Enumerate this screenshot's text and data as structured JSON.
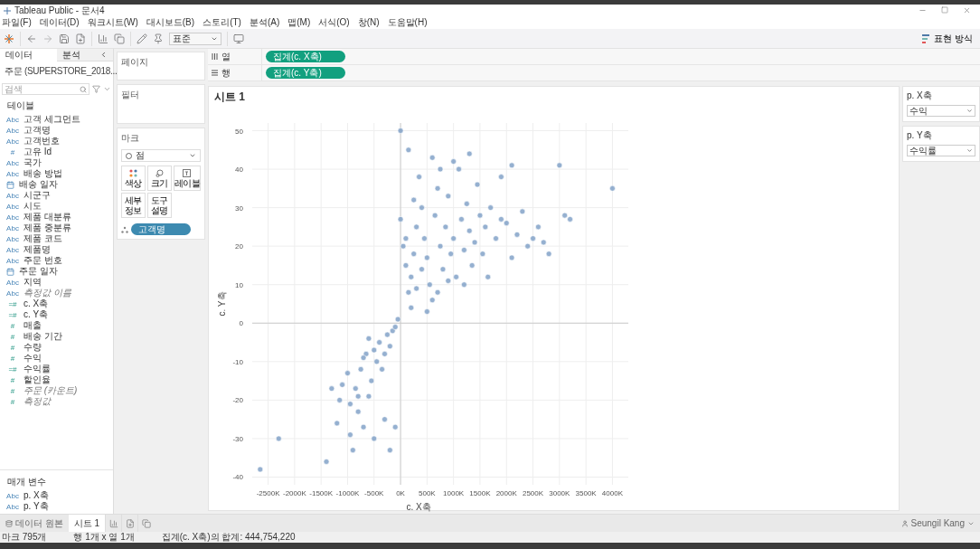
{
  "window": {
    "title": "Tableau Public - 문서4"
  },
  "menu": [
    "파일(F)",
    "데이터(D)",
    "워크시트(W)",
    "대시보드(B)",
    "스토리(T)",
    "분석(A)",
    "맵(M)",
    "서식(O)",
    "창(N)",
    "도움말(H)"
  ],
  "toolbar": {
    "fit_select": "표준",
    "show_me": "표현 방식"
  },
  "data_pane": {
    "tabs": [
      {
        "label": "데이터",
        "selected": true
      },
      {
        "label": "분석",
        "selected": false
      }
    ],
    "datasource": "주문 (SUPERSTORE_2018...",
    "search": {
      "placeholder": "검색"
    },
    "tables_header": "테이블",
    "fields": [
      {
        "kind": "dimension",
        "icon": "Abc",
        "name": "고객 세그먼트",
        "generated": false
      },
      {
        "kind": "dimension",
        "icon": "Abc",
        "name": "고객명",
        "generated": false
      },
      {
        "kind": "dimension",
        "icon": "Abc",
        "name": "고객번호",
        "generated": false
      },
      {
        "kind": "number_dim",
        "icon": "#",
        "name": "고유 Id",
        "generated": false
      },
      {
        "kind": "dimension",
        "icon": "Abc",
        "name": "국가",
        "generated": false
      },
      {
        "kind": "dimension",
        "icon": "Abc",
        "name": "배송 방법",
        "generated": false
      },
      {
        "kind": "date",
        "name": "배송 일자",
        "generated": false
      },
      {
        "kind": "dimension",
        "icon": "Abc",
        "name": "시군구",
        "generated": false
      },
      {
        "kind": "dimension",
        "icon": "Abc",
        "name": "시도",
        "generated": false
      },
      {
        "kind": "dimension",
        "icon": "Abc",
        "name": "제품 대분류",
        "generated": false
      },
      {
        "kind": "dimension",
        "icon": "Abc",
        "name": "제품 중분류",
        "generated": false
      },
      {
        "kind": "dimension",
        "icon": "Abc",
        "name": "제품 코드",
        "generated": false
      },
      {
        "kind": "dimension",
        "icon": "Abc",
        "name": "제품명",
        "generated": false
      },
      {
        "kind": "dimension",
        "icon": "Abc",
        "name": "주문 번호",
        "generated": false
      },
      {
        "kind": "date",
        "name": "주문 일자",
        "generated": false
      },
      {
        "kind": "dimension",
        "icon": "Abc",
        "name": "지역",
        "generated": false
      },
      {
        "kind": "dimension",
        "icon": "Abc",
        "name": "측정값 이름",
        "generated": true
      },
      {
        "kind": "measure",
        "icon": "=#",
        "name": "c. X축",
        "generated": false
      },
      {
        "kind": "measure",
        "icon": "=#",
        "name": "c. Y축",
        "generated": false
      },
      {
        "kind": "measure",
        "icon": "#",
        "name": "매출",
        "generated": false
      },
      {
        "kind": "measure",
        "icon": "#",
        "name": "배송 기간",
        "generated": false
      },
      {
        "kind": "measure",
        "icon": "#",
        "name": "수량",
        "generated": false
      },
      {
        "kind": "measure",
        "icon": "#",
        "name": "수익",
        "generated": false
      },
      {
        "kind": "measure",
        "icon": "=#",
        "name": "수익률",
        "generated": false
      },
      {
        "kind": "measure",
        "icon": "#",
        "name": "할인율",
        "generated": false
      },
      {
        "kind": "measure",
        "icon": "#",
        "name": "주문 (카운트)",
        "generated": true
      },
      {
        "kind": "measure",
        "icon": "#",
        "name": "측정값",
        "generated": true
      }
    ],
    "parameters_header": "매개 변수",
    "parameters": [
      {
        "icon": "Abc",
        "name": "p. X축"
      },
      {
        "icon": "Abc",
        "name": "p. Y축"
      }
    ]
  },
  "cards": {
    "pages": "페이지",
    "filters": "필터",
    "marks": {
      "title": "마크",
      "mark_type": "점",
      "buttons": [
        {
          "kind": "color",
          "label": "색상"
        },
        {
          "kind": "size",
          "label": "크기"
        },
        {
          "kind": "label",
          "label": "레이블"
        },
        {
          "kind": "detail",
          "label": "세부\n정보"
        },
        {
          "kind": "tooltip",
          "label": "도구\n설명"
        }
      ],
      "detail_pill": "고객명"
    }
  },
  "shelves": [
    {
      "kind": "columns",
      "label": "열",
      "pill": "집계(c. X축)"
    },
    {
      "kind": "rows",
      "label": "행",
      "pill": "집계(c. Y축)"
    }
  ],
  "sheet": {
    "title": "시트 1",
    "chart_data": {
      "type": "scatter",
      "grid": true,
      "xlabel": "c. X축",
      "ylabel": "c. Y축",
      "xticks": [
        {
          "value": -2500,
          "label": "-2500K"
        },
        {
          "value": -2000,
          "label": "-2000K"
        },
        {
          "value": -1500,
          "label": "-1500K"
        },
        {
          "value": -1000,
          "label": "-1000K"
        },
        {
          "value": -500,
          "label": "-500K"
        },
        {
          "value": 0,
          "label": "0K"
        },
        {
          "value": 500,
          "label": "500K"
        },
        {
          "value": 1000,
          "label": "1000K"
        },
        {
          "value": 1500,
          "label": "1500K"
        },
        {
          "value": 2000,
          "label": "2000K"
        },
        {
          "value": 2500,
          "label": "2500K"
        },
        {
          "value": 3000,
          "label": "3000K"
        },
        {
          "value": 3500,
          "label": "3500K"
        },
        {
          "value": 4000,
          "label": "4000K"
        }
      ],
      "yticks": [
        -40,
        -30,
        -20,
        -10,
        0,
        10,
        20,
        30,
        40,
        50
      ],
      "xlim": [
        -2800,
        4300
      ],
      "ylim": [
        -42,
        52
      ],
      "x": [
        -2650,
        -2300,
        -1400,
        -1200,
        -900,
        -950,
        -1150,
        -1100,
        -1000,
        -950,
        -700,
        -600,
        -500,
        -300,
        -100,
        -200,
        -800,
        -850,
        -750,
        -650,
        -550,
        -450,
        -400,
        -300,
        -250,
        -200,
        -150,
        -100,
        -50,
        -600,
        -500,
        -350,
        -700,
        0,
        150,
        0,
        50,
        100,
        150,
        200,
        250,
        300,
        350,
        400,
        450,
        500,
        550,
        600,
        650,
        700,
        750,
        800,
        850,
        900,
        950,
        1000,
        1050,
        1100,
        1150,
        1200,
        1250,
        1300,
        1350,
        1400,
        1450,
        1500,
        1550,
        1600,
        1700,
        1800,
        1900,
        2000,
        2100,
        2200,
        2300,
        2400,
        2600,
        2800,
        3000,
        3100,
        3200,
        4000,
        200,
        300,
        400,
        500,
        100,
        250,
        600,
        750,
        1000,
        2100,
        1200,
        700,
        900,
        -800,
        -1300,
        1300,
        2500,
        1650,
        1900,
        2700
      ],
      "series": [
        {
          "color": "#7b9cc4",
          "values": [
            -38,
            -30,
            -36,
            -26,
            -33,
            -29,
            -20,
            -16,
            -13,
            -21,
            -27,
            -19,
            -30,
            -25,
            -27,
            -33,
            -23,
            -17,
            -12,
            -8,
            -15,
            -10,
            -5,
            -8,
            -3,
            -6,
            -2,
            -1,
            1,
            -4,
            -7,
            -12,
            -9,
            50,
            45,
            27,
            20,
            15,
            8,
            12,
            18,
            25,
            38,
            30,
            22,
            17,
            10,
            6,
            28,
            35,
            20,
            14,
            25,
            33,
            18,
            22,
            12,
            40,
            27,
            19,
            31,
            24,
            15,
            21,
            36,
            28,
            18,
            25,
            30,
            22,
            38,
            26,
            17,
            23,
            29,
            20,
            25,
            18,
            41,
            28,
            27,
            35,
            4,
            9,
            14,
            3,
            22,
            32,
            43,
            40,
            42,
            41,
            10,
            8,
            11,
            -19,
            -17,
            44,
            22,
            12,
            27,
            21
          ]
        }
      ]
    }
  },
  "parameter_controls": [
    {
      "label": "p. X축",
      "value": "수익"
    },
    {
      "label": "p. Y축",
      "value": "수익률"
    }
  ],
  "bottom_tabs": {
    "data_source": "데이터 원본",
    "sheets": [
      {
        "label": "시트 1",
        "selected": true
      }
    ]
  },
  "status_bar": {
    "items": [
      "마크 795개",
      "행 1개 x 열 1개",
      "집계(c. X축)의 합계: 444,754,220"
    ],
    "user": "Seungil Kang"
  }
}
